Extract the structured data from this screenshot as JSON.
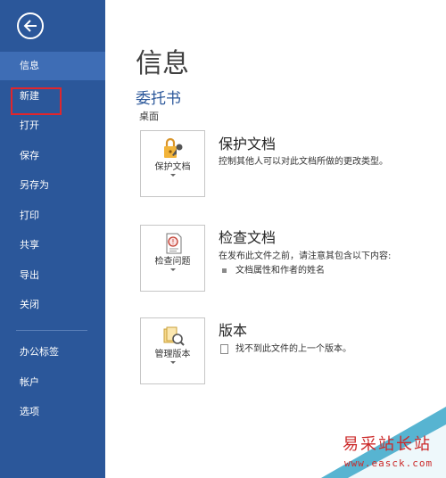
{
  "sidebar": {
    "items": [
      {
        "label": "信息",
        "active": true
      },
      {
        "label": "新建",
        "active": false
      },
      {
        "label": "打开",
        "active": false
      },
      {
        "label": "保存",
        "active": false
      },
      {
        "label": "另存为",
        "active": false
      },
      {
        "label": "打印",
        "active": false
      },
      {
        "label": "共享",
        "active": false
      },
      {
        "label": "导出",
        "active": false
      },
      {
        "label": "关闭",
        "active": false
      }
    ],
    "lower_items": [
      {
        "label": "办公标签"
      },
      {
        "label": "帐户"
      },
      {
        "label": "选项"
      }
    ],
    "back_icon": "back-arrow-icon",
    "bg_color": "#2b579a"
  },
  "main": {
    "title": "信息",
    "document_name": "委托书",
    "document_location": "桌面",
    "sections": [
      {
        "tile_label": "保护文档",
        "tile_icon": "lock-key-icon",
        "heading": "保护文档",
        "text": "控制其他人可以对此文档所做的更改类型。"
      },
      {
        "tile_label": "检查问题",
        "tile_icon": "inspect-document-icon",
        "heading": "检查文档",
        "text": "在发布此文件之前，请注意其包含以下内容:",
        "bullet": "文档属性和作者的姓名"
      },
      {
        "tile_label": "管理版本",
        "tile_icon": "manage-versions-icon",
        "heading": "版本",
        "bullet": "找不到此文件的上一个版本。"
      }
    ]
  },
  "watermark": {
    "text": "易采站长站",
    "url": "www.easck.com"
  }
}
